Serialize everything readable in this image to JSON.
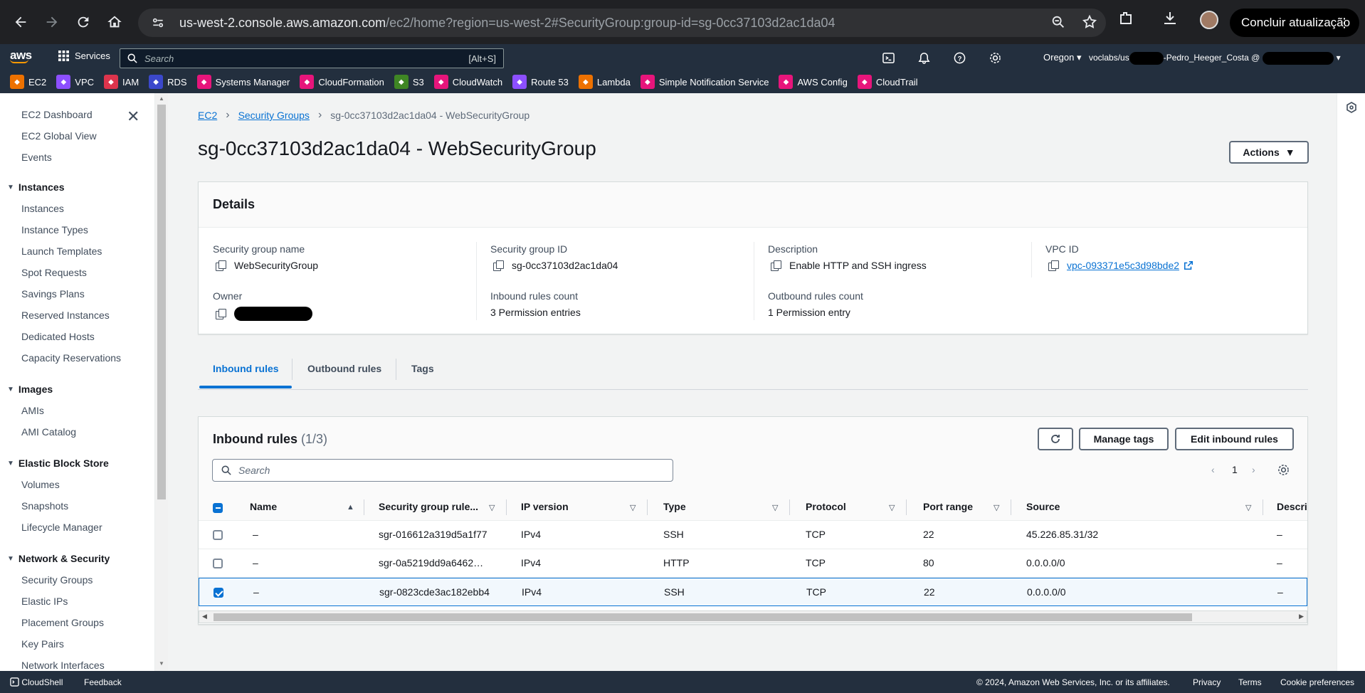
{
  "browser": {
    "url_host": "us-west-2.console.aws.amazon.com",
    "url_path": "/ec2/home?region=us-west-2#SecurityGroup:group-id=sg-0cc37103d2ac1da04",
    "update_label": "Concluir atualização"
  },
  "aws_nav": {
    "logo": "aws",
    "services": "Services",
    "search_placeholder": "Search",
    "search_shortcut": "[Alt+S]",
    "region": "Oregon ▾",
    "account_prefix": "voclabs/us",
    "account_suffix": "-Pedro_Heeger_Costa @"
  },
  "favorites": [
    {
      "label": "EC2",
      "color": "#ed7100",
      "icon": "ec2-icon"
    },
    {
      "label": "VPC",
      "color": "#8c4fff",
      "icon": "vpc-icon"
    },
    {
      "label": "IAM",
      "color": "#dd344c",
      "icon": "iam-icon"
    },
    {
      "label": "RDS",
      "color": "#3b48cc",
      "icon": "rds-icon"
    },
    {
      "label": "Systems Manager",
      "color": "#e7157b",
      "icon": "systems-manager-icon"
    },
    {
      "label": "CloudFormation",
      "color": "#e7157b",
      "icon": "cloudformation-icon"
    },
    {
      "label": "S3",
      "color": "#3f8624",
      "icon": "s3-icon"
    },
    {
      "label": "CloudWatch",
      "color": "#e7157b",
      "icon": "cloudwatch-icon"
    },
    {
      "label": "Route 53",
      "color": "#8c4fff",
      "icon": "route53-icon"
    },
    {
      "label": "Lambda",
      "color": "#ed7100",
      "icon": "lambda-icon"
    },
    {
      "label": "Simple Notification Service",
      "color": "#e7157b",
      "icon": "sns-icon"
    },
    {
      "label": "AWS Config",
      "color": "#e7157b",
      "icon": "config-icon"
    },
    {
      "label": "CloudTrail",
      "color": "#e7157b",
      "icon": "cloudtrail-icon"
    }
  ],
  "sidebar": {
    "top_items": [
      "EC2 Dashboard",
      "EC2 Global View",
      "Events"
    ],
    "sections": [
      {
        "title": "Instances",
        "items": [
          "Instances",
          "Instance Types",
          "Launch Templates",
          "Spot Requests",
          "Savings Plans",
          "Reserved Instances",
          "Dedicated Hosts",
          "Capacity Reservations"
        ]
      },
      {
        "title": "Images",
        "items": [
          "AMIs",
          "AMI Catalog"
        ]
      },
      {
        "title": "Elastic Block Store",
        "items": [
          "Volumes",
          "Snapshots",
          "Lifecycle Manager"
        ]
      },
      {
        "title": "Network & Security",
        "items": [
          "Security Groups",
          "Elastic IPs",
          "Placement Groups",
          "Key Pairs",
          "Network Interfaces"
        ]
      }
    ]
  },
  "breadcrumb": {
    "root": "EC2",
    "parent": "Security Groups",
    "current": "sg-0cc37103d2ac1da04 - WebSecurityGroup"
  },
  "page": {
    "title": "sg-0cc37103d2ac1da04 - WebSecurityGroup",
    "actions_label": "Actions"
  },
  "details": {
    "title": "Details",
    "sg_name_label": "Security group name",
    "sg_name": "WebSecurityGroup",
    "sg_id_label": "Security group ID",
    "sg_id": "sg-0cc37103d2ac1da04",
    "description_label": "Description",
    "description": "Enable HTTP and SSH ingress",
    "vpc_label": "VPC ID",
    "vpc_id": "vpc-093371e5c3d98bde2",
    "owner_label": "Owner",
    "inbound_count_label": "Inbound rules count",
    "inbound_count": "3 Permission entries",
    "outbound_count_label": "Outbound rules count",
    "outbound_count": "1 Permission entry"
  },
  "tabs": [
    "Inbound rules",
    "Outbound rules",
    "Tags"
  ],
  "inbound": {
    "title": "Inbound rules",
    "count": "(1/3)",
    "manage_tags": "Manage tags",
    "edit_rules": "Edit inbound rules",
    "search_placeholder": "Search",
    "page": "1",
    "columns": [
      "Name",
      "Security group rule...",
      "IP version",
      "Type",
      "Protocol",
      "Port range",
      "Source",
      "Descri"
    ],
    "rows": [
      {
        "name": "–",
        "rule_id": "sgr-016612a319d5a1f77",
        "ip": "IPv4",
        "type": "SSH",
        "protocol": "TCP",
        "port": "22",
        "source": "45.226.85.31/32",
        "desc": "–",
        "selected": false
      },
      {
        "name": "–",
        "rule_id": "sgr-0a5219dd9a6462…",
        "ip": "IPv4",
        "type": "HTTP",
        "protocol": "TCP",
        "port": "80",
        "source": "0.0.0.0/0",
        "desc": "–",
        "selected": false
      },
      {
        "name": "–",
        "rule_id": "sgr-0823cde3ac182ebb4",
        "ip": "IPv4",
        "type": "SSH",
        "protocol": "TCP",
        "port": "22",
        "source": "0.0.0.0/0",
        "desc": "–",
        "selected": true
      }
    ]
  },
  "footer": {
    "cloudshell": "CloudShell",
    "feedback": "Feedback",
    "copyright": "© 2024, Amazon Web Services, Inc. or its affiliates.",
    "privacy": "Privacy",
    "terms": "Terms",
    "cookies": "Cookie preferences"
  }
}
